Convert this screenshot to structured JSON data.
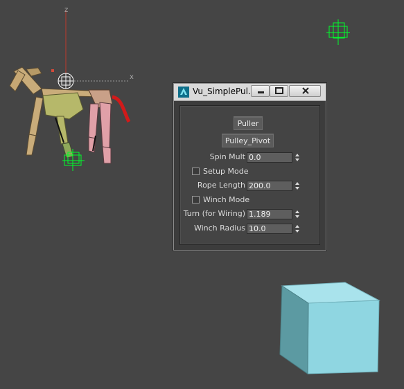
{
  "viewport": {
    "background": "#454545",
    "axis_x_label": "x",
    "axis_z_label": "z",
    "helper_color": "#00ff2a",
    "box_top_color": "#a9e3ec",
    "box_front_color": "#8bd2de",
    "box_side_color": "#5d99a2"
  },
  "dialog": {
    "title": "Vu_SimplePul...",
    "app_icon": "3dsmax-logo-icon",
    "minimize_icon": "minimize-icon",
    "maximize_icon": "maximize-icon",
    "close_icon": "close-icon",
    "puller_button": "Puller",
    "pulley_pivot_button": "Pulley_Pivot",
    "spin_mult": {
      "label": "Spin Mult",
      "value": "0.0"
    },
    "setup_mode": {
      "label": "Setup Mode",
      "checked": false
    },
    "rope_length": {
      "label": "Rope Length",
      "value": "200.0"
    },
    "winch_mode": {
      "label": "Winch Mode",
      "checked": false
    },
    "turn": {
      "label": "Turn (for Wiring)",
      "value": "1.189"
    },
    "winch_radius": {
      "label": "Winch Radius",
      "value": "10.0"
    }
  }
}
